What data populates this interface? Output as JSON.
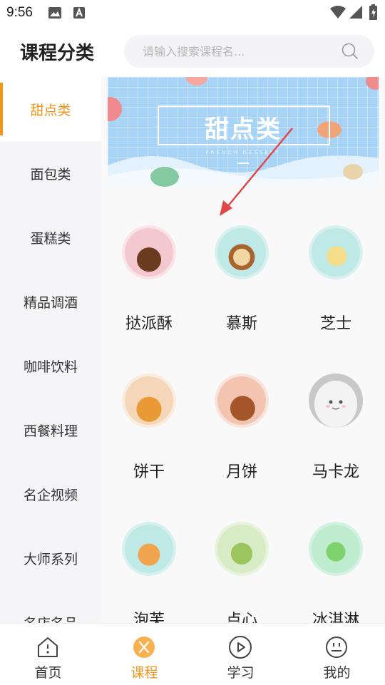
{
  "status_bar": {
    "time": "9:56"
  },
  "header": {
    "title": "课程分类",
    "search": {
      "placeholder": "请输入搜索课程名...",
      "value": ""
    }
  },
  "sidebar": {
    "active_index": 0,
    "items": [
      {
        "label": "甜点类"
      },
      {
        "label": "面包类"
      },
      {
        "label": "蛋糕类"
      },
      {
        "label": "精品调酒"
      },
      {
        "label": "咖啡饮料"
      },
      {
        "label": "西餐料理"
      },
      {
        "label": "名企视频"
      },
      {
        "label": "大师系列"
      },
      {
        "label": "名店名品"
      }
    ]
  },
  "banner": {
    "title": "甜点类",
    "subtitle": "FRENCH DESSERT"
  },
  "grid": {
    "items": [
      {
        "label": "挞派酥",
        "icon": "tart-thumb"
      },
      {
        "label": "慕斯",
        "icon": "mousse-thumb"
      },
      {
        "label": "芝士",
        "icon": "cheese-thumb"
      },
      {
        "label": "饼干",
        "icon": "cookie-thumb"
      },
      {
        "label": "月饼",
        "icon": "mooncake-thumb"
      },
      {
        "label": "马卡龙",
        "icon": "macaron-placeholder-thumb"
      },
      {
        "label": "泡芙",
        "icon": "puff-thumb"
      },
      {
        "label": "点心",
        "icon": "dimsum-thumb"
      },
      {
        "label": "冰淇淋",
        "icon": "icecream-thumb"
      }
    ]
  },
  "tabbar": {
    "active_index": 1,
    "tabs": [
      {
        "label": "首页",
        "icon": "home-icon"
      },
      {
        "label": "课程",
        "icon": "course-icon"
      },
      {
        "label": "学习",
        "icon": "play-icon"
      },
      {
        "label": "我的",
        "icon": "profile-icon"
      }
    ]
  },
  "colors": {
    "accent": "#f0961b",
    "sidebar_bg": "#f5f5f7",
    "banner_bg": "#a7d3f6"
  }
}
